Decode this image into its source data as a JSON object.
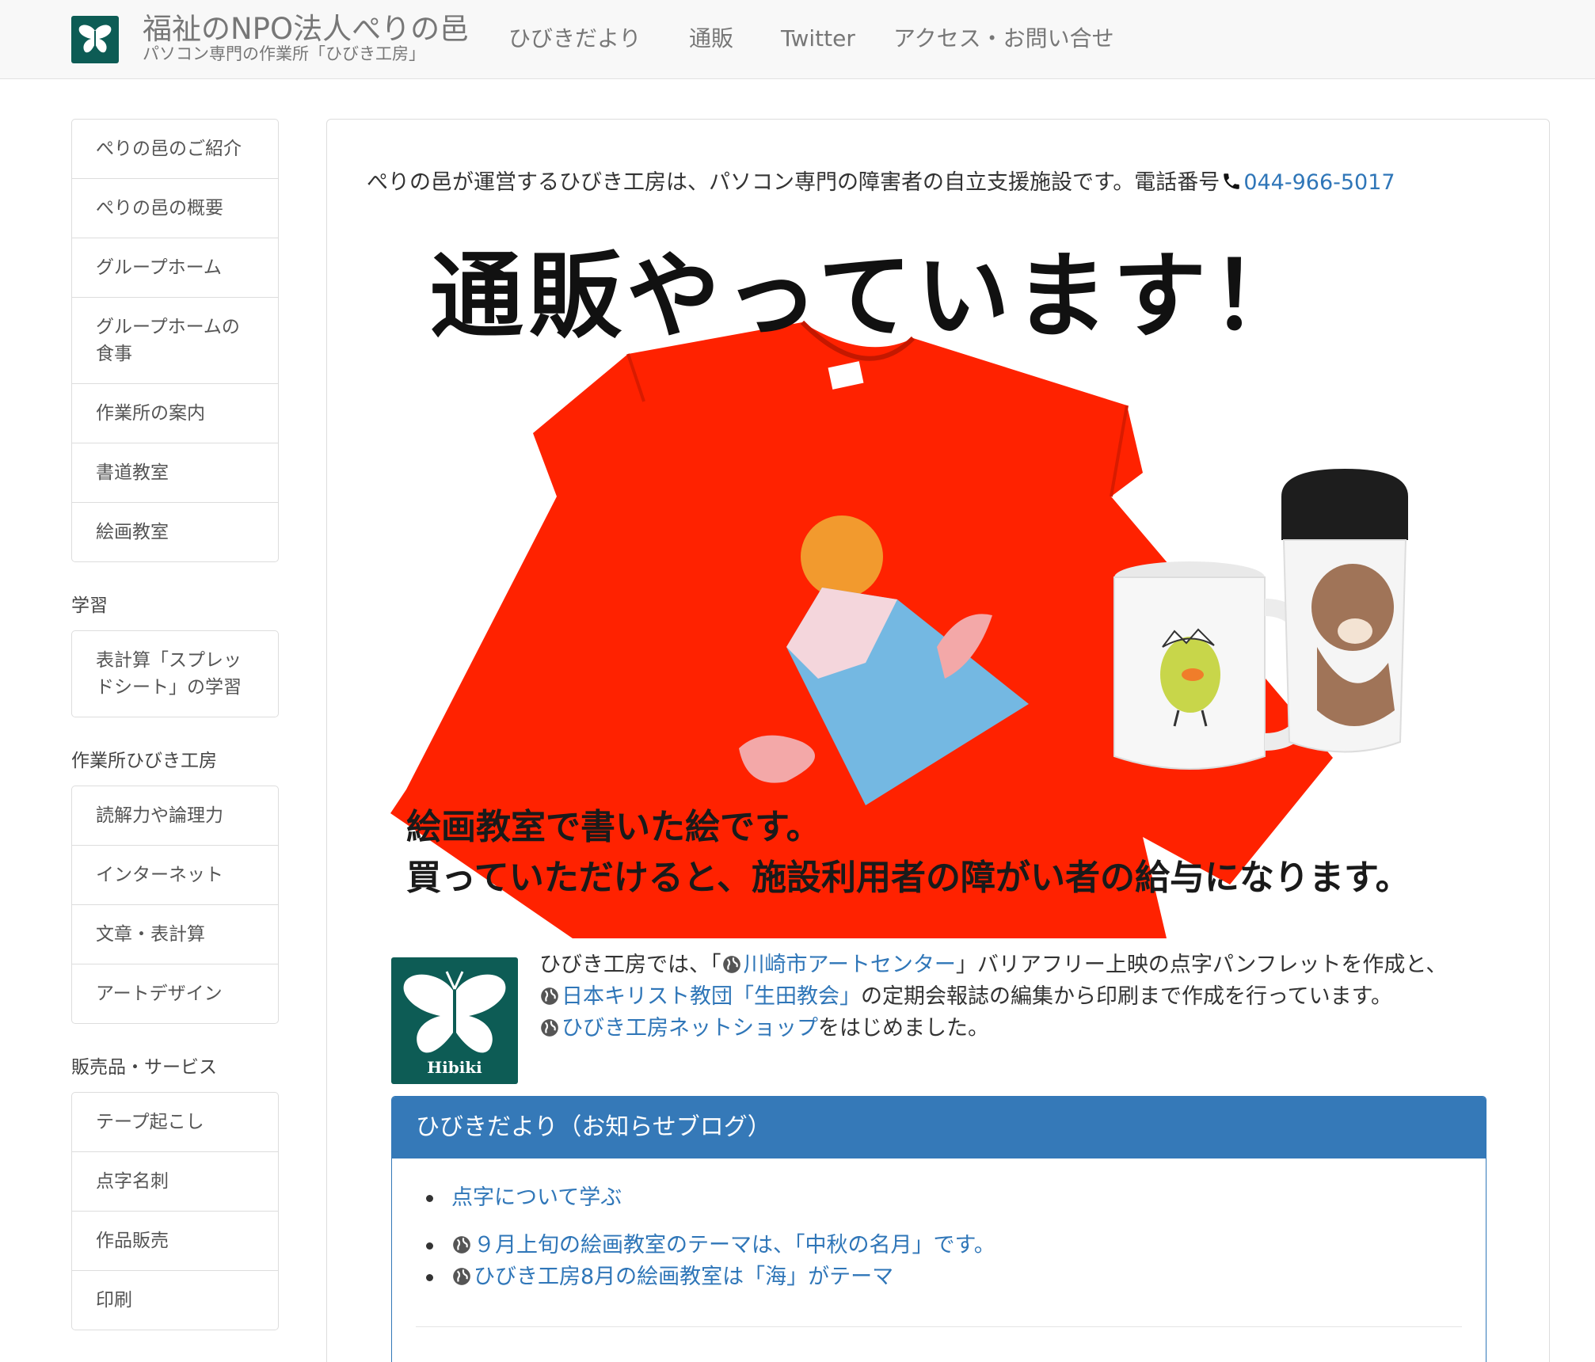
{
  "navbar": {
    "brand_title": "福祉のNPO法人ぺりの邑",
    "brand_subtitle": "パソコン専門の作業所「ひびき工房」",
    "links": [
      "ひびきだより",
      "通販",
      "Twitter",
      "アクセス・お問い合せ"
    ]
  },
  "sidebar": {
    "group1": [
      "ぺりの邑のご紹介",
      "ぺりの邑の概要",
      "グループホーム",
      "グループホームの食事",
      "作業所の案内",
      "書道教室",
      "絵画教室"
    ],
    "heading2": "学習",
    "group2": [
      "表計算「スプレッドシート」の学習"
    ],
    "heading3": "作業所ひびき工房",
    "group3": [
      "読解力や論理力",
      "インターネット",
      "文章・表計算",
      "アートデザイン"
    ],
    "heading4": "販売品・サービス",
    "group4": [
      "テープ起こし",
      "点字名刺",
      "作品販売",
      "印刷"
    ]
  },
  "main": {
    "intro_text": "ぺりの邑が運営するひびき工房は、パソコン専門の障害者の自立支援施設です。電話番号",
    "phone": "044-966-5017",
    "banner": {
      "headline": "通販やっています！",
      "line1": "絵画教室で書いた絵です。",
      "line2": "買っていただけると、施設利用者の障がい者の給与になります。"
    },
    "logo_label": "Hibiki",
    "desc": {
      "l1_pre": "ひびき工房では、「",
      "l1_link": "川崎市アートセンター",
      "l1_post": "」バリアフリー上映の点字パンフレットを作成と、",
      "l2_link": "日本キリスト教団「生田教会」",
      "l2_post": "の定期会報誌の編集から印刷まで作成を行っています。",
      "l3_link": "ひびき工房ネットショップ",
      "l3_post": "をはじめました。"
    },
    "blog": {
      "title": "ひびきだより（お知らせブログ）",
      "items": [
        "点字について学ぶ",
        "９月上旬の絵画教室のテーマは、「中秋の名月」です。",
        "ひびき工房8月の絵画教室は「海」がテーマ"
      ]
    }
  },
  "colors": {
    "accent": "#3579b8",
    "link": "#2f76b8",
    "logo_bg": "#0d5c55",
    "shirt": "#ff2200"
  }
}
